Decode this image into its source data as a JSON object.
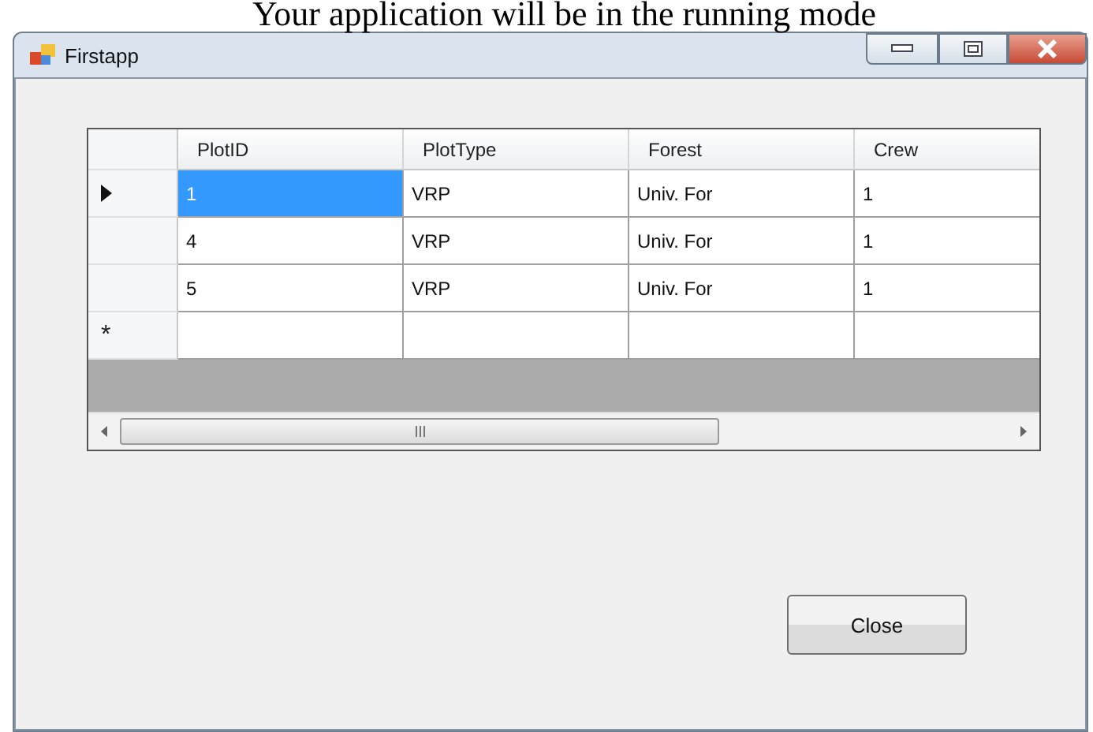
{
  "document_text": "Your application will be in the running mode",
  "window": {
    "title": "Firstapp"
  },
  "grid": {
    "columns": [
      "PlotID",
      "PlotType",
      "Forest",
      "Crew"
    ],
    "rows": [
      {
        "current": true,
        "cells": [
          {
            "text": "1",
            "selected": true
          },
          {
            "text": "VRP",
            "selected": false
          },
          {
            "text": "Univ. For",
            "selected": false
          },
          {
            "text": "1",
            "selected": false
          }
        ]
      },
      {
        "current": false,
        "cells": [
          {
            "text": "4",
            "selected": false
          },
          {
            "text": "VRP",
            "selected": false
          },
          {
            "text": "Univ. For",
            "selected": false
          },
          {
            "text": "1",
            "selected": false
          }
        ]
      },
      {
        "current": false,
        "cells": [
          {
            "text": "5",
            "selected": false
          },
          {
            "text": "VRP",
            "selected": false
          },
          {
            "text": "Univ. For",
            "selected": false
          },
          {
            "text": "1",
            "selected": false
          }
        ]
      }
    ],
    "new_row_marker": "*"
  },
  "buttons": [
    {
      "label": "Close"
    }
  ]
}
